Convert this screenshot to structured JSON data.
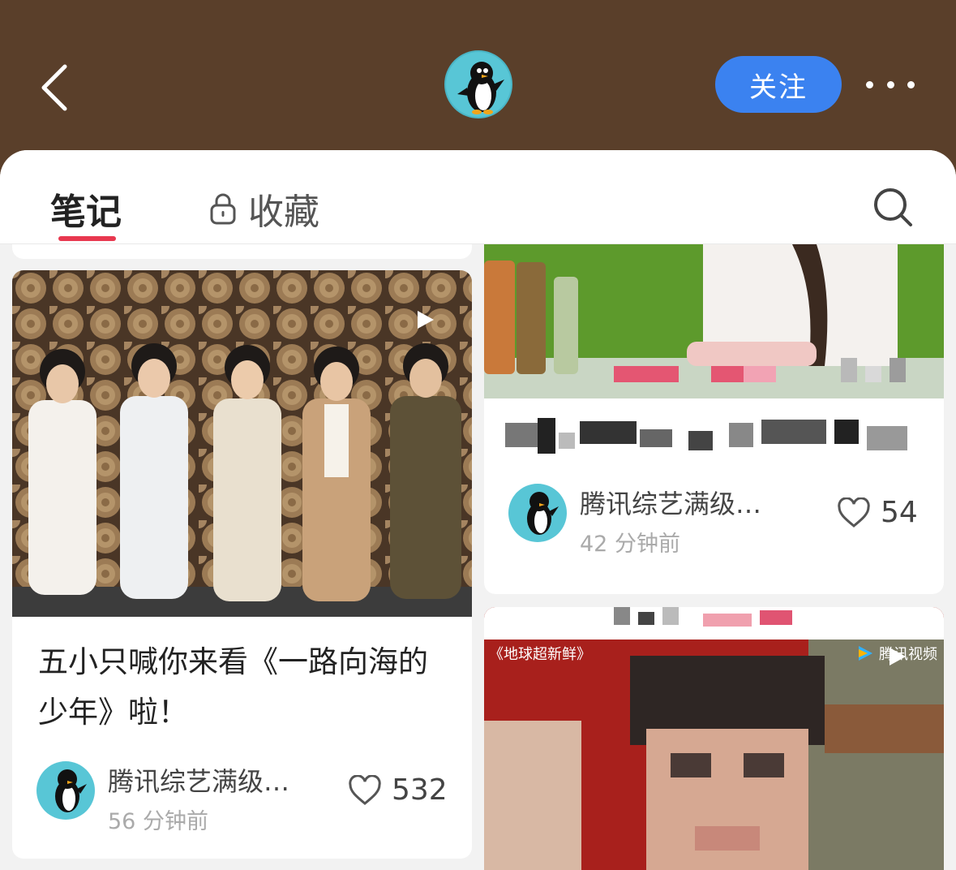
{
  "header": {
    "follow_label": "关注",
    "colors": {
      "bg": "#5a3f2a",
      "follow": "#3b82f0"
    }
  },
  "tabs": {
    "notes_label": "笔记",
    "favorites_label": "收藏",
    "active_color": "#e8384f"
  },
  "feed": {
    "card1": {
      "title": "五小只喊你来看《一路向海的少年》啦！",
      "author": "腾讯综艺满级…",
      "time": "56 分钟前",
      "likes": "532",
      "icon": "play-icon"
    },
    "card2": {
      "author": "腾讯综艺满级…",
      "time": "42 分钟前",
      "likes": "54"
    },
    "card3": {
      "source": "《地球超新鲜》",
      "brand": "腾讯视频",
      "icon": "play-icon"
    }
  }
}
